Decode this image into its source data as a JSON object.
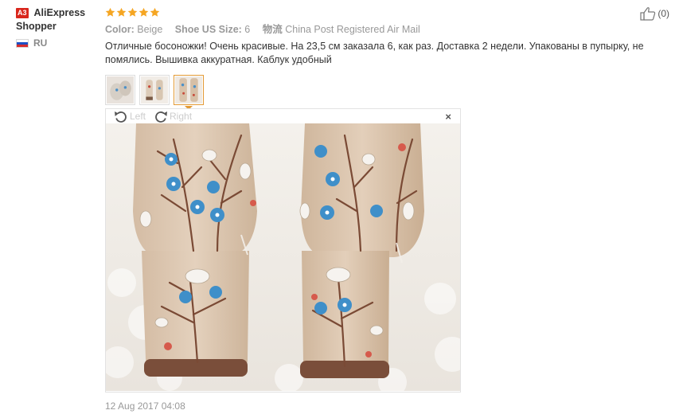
{
  "user": {
    "badge": "A3",
    "name_line1": "AliExpress",
    "name_line2": "Shopper",
    "country_code": "RU"
  },
  "rating": {
    "stars": 5,
    "star_color": "#f5a623"
  },
  "meta": {
    "color_label": "Color:",
    "color_value": "Beige",
    "size_label": "Shoe US Size:",
    "size_value": "6",
    "shipping_label": "物流",
    "shipping_value": "China Post Registered Air Mail"
  },
  "review_text": "Отличные босоножки! Очень красивые. На 23,5 см заказала 6, как раз. Доставка 2 недели. Упакованы в пупырку, не помялись. Вышивка аккуратная. Каблук удобный",
  "thumbnails": [
    {
      "name": "photo-1"
    },
    {
      "name": "photo-2"
    },
    {
      "name": "photo-3",
      "active": true
    }
  ],
  "viewer": {
    "rotate_left_label": "Left",
    "rotate_right_label": "Right",
    "close_label": "×"
  },
  "helpful": {
    "count": "(0)"
  },
  "date": "12 Aug 2017 04:08",
  "colors": {
    "accent": "#e39a35",
    "badge": "#d9261c"
  }
}
